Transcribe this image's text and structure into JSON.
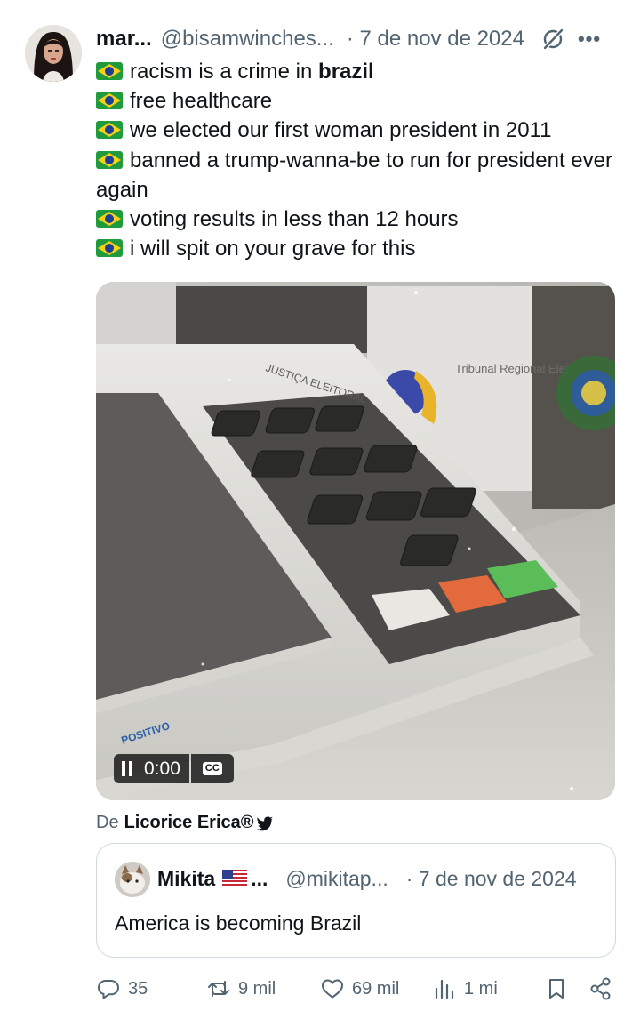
{
  "post": {
    "author_name": "mar...",
    "author_handle": "@bisamwinches...",
    "date": "· 7 de nov de 2024",
    "lines": [
      {
        "flag": "brazil-flag-emoji",
        "text": "racism is a crime in ",
        "bold": "brazil"
      },
      {
        "flag": "brazil-flag-emoji",
        "text": "free healthcare"
      },
      {
        "flag": "brazil-flag-emoji",
        "text": "we elected our first woman president in 2011"
      },
      {
        "flag": "brazil-flag-emoji",
        "text": "banned a trump-wanna-be to run for president ever again"
      },
      {
        "flag": "brazil-flag-emoji",
        "text": "voting results in less than 12 hours"
      },
      {
        "flag": "brazil-flag-emoji",
        "text": "i will spit on your grave for this"
      }
    ]
  },
  "media": {
    "time": "0:00",
    "cc_label": "CC",
    "screen_text_1": "JUSTIÇA ELEITORAL",
    "screen_text_2": "Tribunal Regional Eleitoral"
  },
  "attribution": {
    "prefix": "De",
    "source": "Licorice Erica®"
  },
  "quote": {
    "name": "Mikita",
    "flag": "us-flag-emoji",
    "dots": "...",
    "handle": "@mikitap...",
    "date": "· 7 de nov de 2024",
    "text": "America is becoming Brazil"
  },
  "actions": {
    "replies": "35",
    "reposts": "9 mil",
    "likes": "69 mil",
    "views": "1 mi"
  },
  "colors": {
    "text": "#0f1419",
    "secondary": "#536471",
    "border": "#cfd9de"
  }
}
